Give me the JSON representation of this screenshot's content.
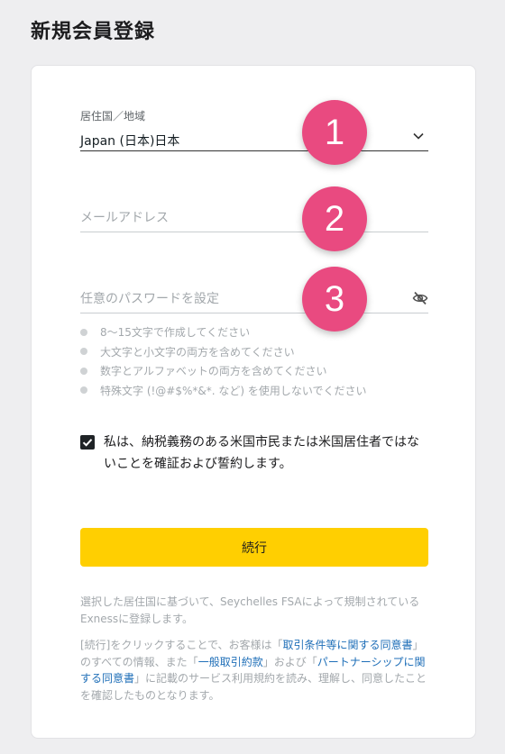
{
  "page": {
    "title": "新規会員登録"
  },
  "form": {
    "country": {
      "label": "居住国／地域",
      "value": "Japan (日本)日本"
    },
    "email": {
      "placeholder": "メールアドレス"
    },
    "password": {
      "placeholder": "任意のパスワードを設定"
    },
    "password_rules": [
      "8～15文字で作成してください",
      "大文字と小文字の両方を含めてください",
      "数字とアルファベットの両方を含めてください",
      "特殊文字 (!@#$%*&*. など) を使用しないでください"
    ],
    "confirm": {
      "checked": true,
      "text": "私は、納税義務のある米国市民または米国居住者ではないことを確証および誓約します。"
    },
    "submit_label": "続行"
  },
  "badges": [
    "1",
    "2",
    "3"
  ],
  "footer": {
    "regulation_note": "選択した居住国に基づいて、Seychelles FSAによって規制されているExnessに登録します。",
    "consent": {
      "prefix": "[続行]をクリックすることで、お客様は「",
      "link1": "取引条件等に関する同意書",
      "mid1": "」のすべての情報、また「",
      "link2": "一般取引約款",
      "mid2": "」および「",
      "link3": "パートナーシップに関する同意書",
      "suffix": "」に記載のサービス利用規約を読み、理解し、同意したことを確認したものとなります。"
    }
  },
  "colors": {
    "accent_button": "#ffcf01",
    "badge": "#e94a80",
    "link": "#1f6fb8"
  }
}
